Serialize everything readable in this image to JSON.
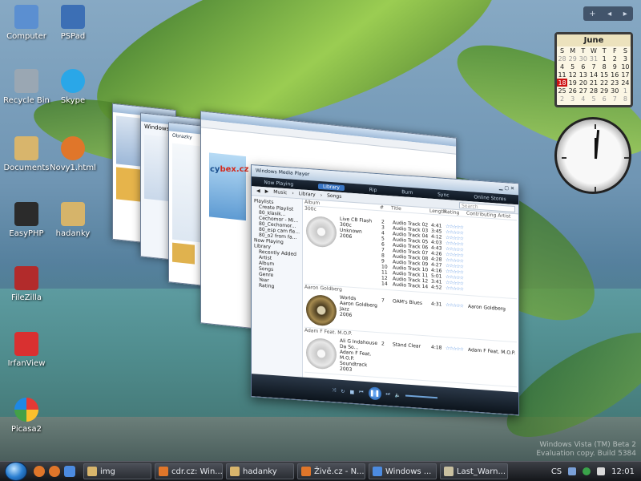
{
  "desktop_icons": [
    {
      "label": "Computer",
      "color": "#5b8fd1"
    },
    {
      "label": "PSPad",
      "color": "#3c6fb5"
    },
    {
      "label": "Recycle Bin",
      "color": "#9aa7b3"
    },
    {
      "label": "Skype",
      "color": "#2aa7e8"
    },
    {
      "label": "Documents",
      "color": "#d8b56c"
    },
    {
      "label": "Novy1.html",
      "color": "#e0762a"
    },
    {
      "label": "EasyPHP",
      "color": "#2b2b2b"
    },
    {
      "label": "hadanky",
      "color": "#d6b46a"
    },
    {
      "label": "FileZilla",
      "color": "#b22b2b"
    },
    {
      "label": "IrfanView",
      "color": "#d93030"
    },
    {
      "label": "Picasa2",
      "color": "#f3f3f3"
    }
  ],
  "calendar": {
    "month": "June",
    "weekdays": [
      "S",
      "M",
      "T",
      "W",
      "T",
      "F",
      "S"
    ],
    "weeks": [
      [
        "28",
        "29",
        "30",
        "31",
        "1",
        "2",
        "3"
      ],
      [
        "4",
        "5",
        "6",
        "7",
        "8",
        "9",
        "10"
      ],
      [
        "11",
        "12",
        "13",
        "14",
        "15",
        "16",
        "17"
      ],
      [
        "18",
        "19",
        "20",
        "21",
        "22",
        "23",
        "24"
      ],
      [
        "25",
        "26",
        "27",
        "28",
        "29",
        "30",
        "1"
      ],
      [
        "2",
        "3",
        "4",
        "5",
        "6",
        "7",
        "8"
      ]
    ],
    "today": "18"
  },
  "sidebar_controls": {
    "add": "+",
    "prev": "◂",
    "next": "▸"
  },
  "flip_windows": {
    "browser_title": "Windows V",
    "explorer_title": "Obrazky",
    "cybex_logo_prefix": "cy",
    "cybex_logo_suffix": "bex.cz"
  },
  "media_player": {
    "title": "Windows Media Player",
    "tabs": [
      "Now Playing",
      "Library",
      "Rip",
      "Burn",
      "Sync",
      "Online Stores"
    ],
    "active_tab": "Library",
    "breadcrumb": [
      "Music",
      "Library",
      "Songs"
    ],
    "search_placeholder": "Search",
    "nav_items": [
      "Playlists",
      "Create Playlist",
      "80_klasik...",
      "Cechomor - Mi...",
      "80_Cechomor...",
      "80_esp cam fle...",
      "80_o2 from fa...",
      "Now Playing",
      "Library",
      "Recently Added",
      "Artist",
      "Album",
      "Songs",
      "Genre",
      "Year",
      "Rating"
    ],
    "columns": [
      "Album",
      "",
      "#",
      "Title",
      "Length",
      "Rating",
      "Contributing Artist"
    ],
    "album_artist_header": "Album",
    "albums": [
      {
        "group_label": "300c",
        "title": "Live CB Flash",
        "line2": "300c",
        "genre": "Unknown",
        "year": "2006",
        "art": "light",
        "tracks": [
          {
            "n": "2",
            "title": "Audio Track 02",
            "length": "4:41"
          },
          {
            "n": "3",
            "title": "Audio Track 03",
            "length": "3:45"
          },
          {
            "n": "4",
            "title": "Audio Track 04",
            "length": "4:12"
          },
          {
            "n": "5",
            "title": "Audio Track 05",
            "length": "4:03"
          },
          {
            "n": "6",
            "title": "Audio Track 06",
            "length": "4:43"
          },
          {
            "n": "7",
            "title": "Audio Track 07",
            "length": "4:26"
          },
          {
            "n": "8",
            "title": "Audio Track 08",
            "length": "4:28"
          },
          {
            "n": "9",
            "title": "Audio Track 09",
            "length": "4:27"
          },
          {
            "n": "10",
            "title": "Audio Track 10",
            "length": "4:16"
          },
          {
            "n": "11",
            "title": "Audio Track 11",
            "length": "5:01"
          },
          {
            "n": "12",
            "title": "Audio Track 12",
            "length": "3:41"
          },
          {
            "n": "14",
            "title": "Audio Track 14",
            "length": "4:52"
          }
        ]
      },
      {
        "group_label": "Aaron Goldberg",
        "title": "Worlds",
        "line2": "Aaron Goldberg",
        "genre": "Jazz",
        "year": "2006",
        "art": "dark",
        "tracks": [
          {
            "n": "7",
            "title": "OAM's Blues",
            "length": "4:31",
            "artist": "Aaron Goldberg"
          }
        ]
      },
      {
        "group_label": "Adam F Feat. M.O.P.",
        "title": "Ali G Indahouse Da So...",
        "line2": "Adam F Feat. M.O.P.",
        "genre": "Soundtrack",
        "year": "2003",
        "art": "light",
        "tracks": [
          {
            "n": "2",
            "title": "Stand Clear",
            "length": "4:18",
            "artist": "Adam F Feat. M.O.P."
          }
        ]
      }
    ],
    "stars": "☆☆☆☆☆"
  },
  "taskbar": {
    "tasks": [
      {
        "label": "img",
        "color": "#d8b56c"
      },
      {
        "label": "cdr.cz: Win...",
        "color": "#e0762a"
      },
      {
        "label": "hadanky",
        "color": "#d8b56c"
      },
      {
        "label": "Živě.cz - N...",
        "color": "#e0762a"
      },
      {
        "label": "Windows ...",
        "color": "#4c8be0"
      },
      {
        "label": "Last_Warn...",
        "color": "#c9c0a0"
      }
    ],
    "language": "CS",
    "time": "12:01"
  },
  "watermark": {
    "line1": "Windows Vista (TM) Beta 2",
    "line2": "Evaluation copy. Build 5384"
  }
}
